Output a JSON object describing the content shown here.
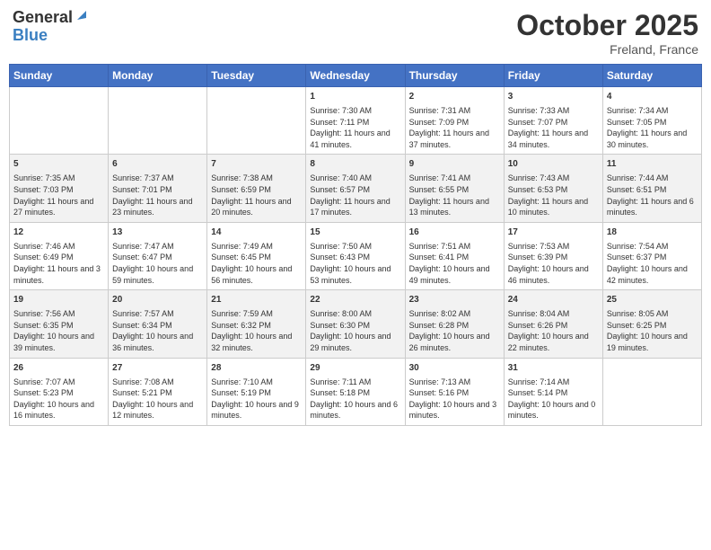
{
  "header": {
    "logo_line1": "General",
    "logo_line2": "Blue",
    "month": "October 2025",
    "location": "Freland, France"
  },
  "days_of_week": [
    "Sunday",
    "Monday",
    "Tuesday",
    "Wednesday",
    "Thursday",
    "Friday",
    "Saturday"
  ],
  "weeks": [
    [
      {
        "day": "",
        "info": ""
      },
      {
        "day": "",
        "info": ""
      },
      {
        "day": "",
        "info": ""
      },
      {
        "day": "1",
        "info": "Sunrise: 7:30 AM\nSunset: 7:11 PM\nDaylight: 11 hours and 41 minutes."
      },
      {
        "day": "2",
        "info": "Sunrise: 7:31 AM\nSunset: 7:09 PM\nDaylight: 11 hours and 37 minutes."
      },
      {
        "day": "3",
        "info": "Sunrise: 7:33 AM\nSunset: 7:07 PM\nDaylight: 11 hours and 34 minutes."
      },
      {
        "day": "4",
        "info": "Sunrise: 7:34 AM\nSunset: 7:05 PM\nDaylight: 11 hours and 30 minutes."
      }
    ],
    [
      {
        "day": "5",
        "info": "Sunrise: 7:35 AM\nSunset: 7:03 PM\nDaylight: 11 hours and 27 minutes."
      },
      {
        "day": "6",
        "info": "Sunrise: 7:37 AM\nSunset: 7:01 PM\nDaylight: 11 hours and 23 minutes."
      },
      {
        "day": "7",
        "info": "Sunrise: 7:38 AM\nSunset: 6:59 PM\nDaylight: 11 hours and 20 minutes."
      },
      {
        "day": "8",
        "info": "Sunrise: 7:40 AM\nSunset: 6:57 PM\nDaylight: 11 hours and 17 minutes."
      },
      {
        "day": "9",
        "info": "Sunrise: 7:41 AM\nSunset: 6:55 PM\nDaylight: 11 hours and 13 minutes."
      },
      {
        "day": "10",
        "info": "Sunrise: 7:43 AM\nSunset: 6:53 PM\nDaylight: 11 hours and 10 minutes."
      },
      {
        "day": "11",
        "info": "Sunrise: 7:44 AM\nSunset: 6:51 PM\nDaylight: 11 hours and 6 minutes."
      }
    ],
    [
      {
        "day": "12",
        "info": "Sunrise: 7:46 AM\nSunset: 6:49 PM\nDaylight: 11 hours and 3 minutes."
      },
      {
        "day": "13",
        "info": "Sunrise: 7:47 AM\nSunset: 6:47 PM\nDaylight: 10 hours and 59 minutes."
      },
      {
        "day": "14",
        "info": "Sunrise: 7:49 AM\nSunset: 6:45 PM\nDaylight: 10 hours and 56 minutes."
      },
      {
        "day": "15",
        "info": "Sunrise: 7:50 AM\nSunset: 6:43 PM\nDaylight: 10 hours and 53 minutes."
      },
      {
        "day": "16",
        "info": "Sunrise: 7:51 AM\nSunset: 6:41 PM\nDaylight: 10 hours and 49 minutes."
      },
      {
        "day": "17",
        "info": "Sunrise: 7:53 AM\nSunset: 6:39 PM\nDaylight: 10 hours and 46 minutes."
      },
      {
        "day": "18",
        "info": "Sunrise: 7:54 AM\nSunset: 6:37 PM\nDaylight: 10 hours and 42 minutes."
      }
    ],
    [
      {
        "day": "19",
        "info": "Sunrise: 7:56 AM\nSunset: 6:35 PM\nDaylight: 10 hours and 39 minutes."
      },
      {
        "day": "20",
        "info": "Sunrise: 7:57 AM\nSunset: 6:34 PM\nDaylight: 10 hours and 36 minutes."
      },
      {
        "day": "21",
        "info": "Sunrise: 7:59 AM\nSunset: 6:32 PM\nDaylight: 10 hours and 32 minutes."
      },
      {
        "day": "22",
        "info": "Sunrise: 8:00 AM\nSunset: 6:30 PM\nDaylight: 10 hours and 29 minutes."
      },
      {
        "day": "23",
        "info": "Sunrise: 8:02 AM\nSunset: 6:28 PM\nDaylight: 10 hours and 26 minutes."
      },
      {
        "day": "24",
        "info": "Sunrise: 8:04 AM\nSunset: 6:26 PM\nDaylight: 10 hours and 22 minutes."
      },
      {
        "day": "25",
        "info": "Sunrise: 8:05 AM\nSunset: 6:25 PM\nDaylight: 10 hours and 19 minutes."
      }
    ],
    [
      {
        "day": "26",
        "info": "Sunrise: 7:07 AM\nSunset: 5:23 PM\nDaylight: 10 hours and 16 minutes."
      },
      {
        "day": "27",
        "info": "Sunrise: 7:08 AM\nSunset: 5:21 PM\nDaylight: 10 hours and 12 minutes."
      },
      {
        "day": "28",
        "info": "Sunrise: 7:10 AM\nSunset: 5:19 PM\nDaylight: 10 hours and 9 minutes."
      },
      {
        "day": "29",
        "info": "Sunrise: 7:11 AM\nSunset: 5:18 PM\nDaylight: 10 hours and 6 minutes."
      },
      {
        "day": "30",
        "info": "Sunrise: 7:13 AM\nSunset: 5:16 PM\nDaylight: 10 hours and 3 minutes."
      },
      {
        "day": "31",
        "info": "Sunrise: 7:14 AM\nSunset: 5:14 PM\nDaylight: 10 hours and 0 minutes."
      },
      {
        "day": "",
        "info": ""
      }
    ]
  ]
}
